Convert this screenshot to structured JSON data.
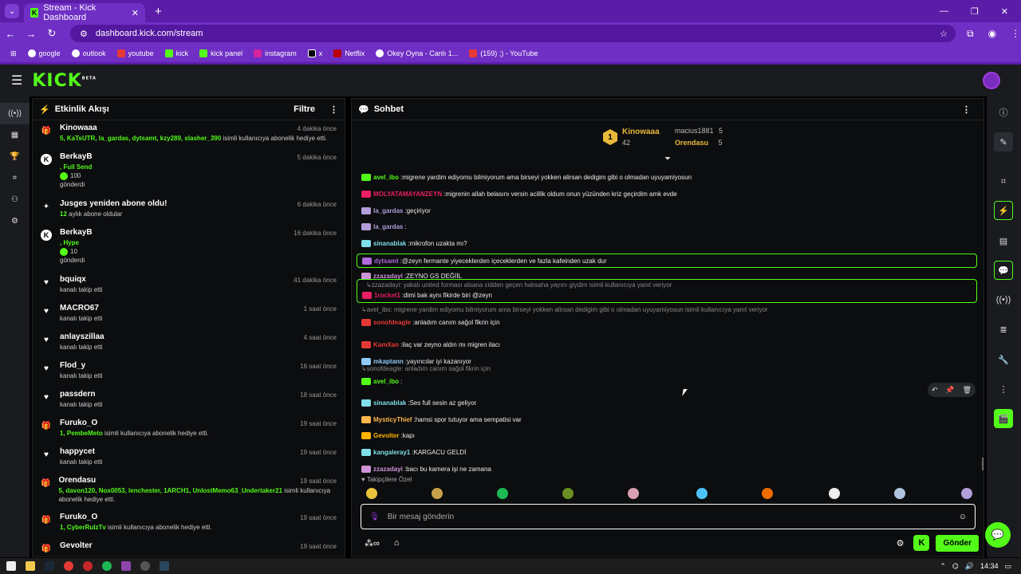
{
  "browser": {
    "tab_title": "Stream - Kick Dashboard",
    "url": "dashboard.kick.com/stream",
    "bookmarks": [
      "google",
      "outlook",
      "youtube",
      "kick",
      "kick panel",
      "instagram",
      "x",
      "Netflix",
      "Okey Oyna - Canlı 1...",
      "(159) ;) - YouTube"
    ]
  },
  "app": {
    "logo": "KICK",
    "logo_tag": "BETA"
  },
  "activity": {
    "title": "Etkinlik Akışı",
    "filter": "Filtre",
    "items": [
      {
        "icon": "gift",
        "name": "Kinowaaa",
        "time": "4 dakika önce",
        "green": "5, KaTsUTR, la_gardas, dytsamt, kzy289, slasher_390",
        "text": " isimli kullanıcıya abonelik hediye etti."
      },
      {
        "icon": "kick",
        "name": "BerkayB",
        "time": "5 dakika önce",
        "green": ", Full Send",
        "amount": "100",
        "text": "gönderdi"
      },
      {
        "icon": "star",
        "name": "Jusges yeniden abone oldu!",
        "time": "6 dakika önce",
        "green": "12",
        "text": " aylık abone oldular"
      },
      {
        "icon": "kick",
        "name": "BerkayB",
        "time": "16 dakika önce",
        "green": ", Hype",
        "amount": "10",
        "text": "gönderdi"
      },
      {
        "icon": "heart",
        "name": "bquiqx",
        "time": "41 dakika önce",
        "text": "kanalı takip etti"
      },
      {
        "icon": "heart",
        "name": "MACRO67",
        "time": "1 saat önce",
        "text": "kanalı takip etti"
      },
      {
        "icon": "heart",
        "name": "anlayszillaa",
        "time": "4 saat önce",
        "text": "kanalı takip etti"
      },
      {
        "icon": "heart",
        "name": "Flod_y",
        "time": "16 saat önce",
        "text": "kanalı takip etti"
      },
      {
        "icon": "heart",
        "name": "passdern",
        "time": "18 saat önce",
        "text": "kanalı takip etti"
      },
      {
        "icon": "gift",
        "name": "Furuko_O",
        "time": "19 saat önce",
        "green": "1, PembeMeto",
        "text": " isimli kullanıcıya abonelik hediye etti."
      },
      {
        "icon": "heart",
        "name": "happycet",
        "time": "19 saat önce",
        "text": "kanalı takip etti"
      },
      {
        "icon": "gift",
        "name": "Orendasu",
        "time": "19 saat önce",
        "green": "5, davon120, Nox0053, lenchester, 1ARCH1, UnlostMemo63_Undertaker21",
        "text": " isimli kullanıcıya abonelik hediye etti."
      },
      {
        "icon": "gift",
        "name": "Furuko_O",
        "time": "19 saat önce",
        "green": "1, CyberRulzTv",
        "text": " isimli kullanıcıya abonelik hediye etti."
      },
      {
        "icon": "gift",
        "name": "Gevolter",
        "time": "19 saat önce",
        "text": ""
      }
    ]
  },
  "chat": {
    "title": "Sohbet",
    "leaderboard": {
      "first": "Kinowaaa",
      "first_count": "42",
      "second": "macius1881",
      "second_count": "5",
      "third": "Orendasu",
      "third_count": "5"
    },
    "messages": [
      {
        "user": "avel_ibo",
        "color": "#53fc18",
        "text": "migrene yardim ediyomu bilmiyorum ama birseyi yokken alirsan dedigim gibi o olmadan uyuyamiyosun"
      },
      {
        "user": "MOLYATAMAYANZEYN",
        "color": "#e91e63",
        "text": "migrenin allah belasını versin acillik oldum onun yüzünden kriz geçirdim amk evde"
      },
      {
        "user": "la_gardas",
        "color": "#b39ddb",
        "text": "geçiriyor"
      },
      {
        "user": "la_gardas",
        "color": "#b39ddb",
        "text": ""
      },
      {
        "user": "sinanablak",
        "color": "#80deea",
        "text": "mikrofon uzakta mı?"
      },
      {
        "user": "dytsamt",
        "color": "#b06ad9",
        "text": "@zeyn fermante yiyeceklerden içeceklerden ve fazla kafeinden uzak dur"
      },
      {
        "user": "zzazadayi",
        "color": "#ce93d8",
        "text": "ZEYNO GS DEĞİİL"
      },
      {
        "reply": "zzazadayi: yakalı united forması alsana cidden geçen halısaha yayını giydim isimli kullanıcıya yanıt veriyor",
        "user": "1rocket1",
        "color": "#e91e63",
        "text": "dimi bak aynı fikirde biri @zeyn"
      },
      {
        "reply": "avel_ibo: migrene yardim ediyomu bilmiyorum ama birseyi yokken alirsan dedigim gibi o olmadan uyuyamiyosun isimli kullanıcıya yanıt veriyor",
        "user": "sonofdeagle",
        "color": "#e53935",
        "text": "anladım canım sağol fikrin için"
      },
      {
        "user": "KamXan",
        "color": "#e53935",
        "text": "ilaç var zeyno aldın mı migren ilacı"
      },
      {
        "user": "mkaptann",
        "color": "#90caf9",
        "text": "yayıncılar iyi kazanıyor"
      },
      {
        "reply": "sonofdeagle: anladım canım sağol fikrin için",
        "user": "avel_ibo",
        "color": "#53fc18",
        "text": ""
      },
      {
        "user": "sinanablak",
        "color": "#80deea",
        "text": "Ses full sesin az geliyor"
      },
      {
        "user": "MysticyThief",
        "color": "#ffb74d",
        "text": "hamsi spor tutuyor ama sempatisi var"
      },
      {
        "user": "Gevolter",
        "color": "#ffb300",
        "text": "kapı"
      },
      {
        "user": "kangaleray1",
        "color": "#80deea",
        "text": "KARGACU GELDİ"
      },
      {
        "user": "zzazadayi",
        "color": "#ce93d8",
        "text": "bacı bu kamera işi ne zamana"
      }
    ],
    "followers_label": "Takipçilere Özel",
    "input_placeholder": "Bir mesaj gönderin",
    "send": "Gönder"
  },
  "taskbar": {
    "time": "14:34"
  }
}
